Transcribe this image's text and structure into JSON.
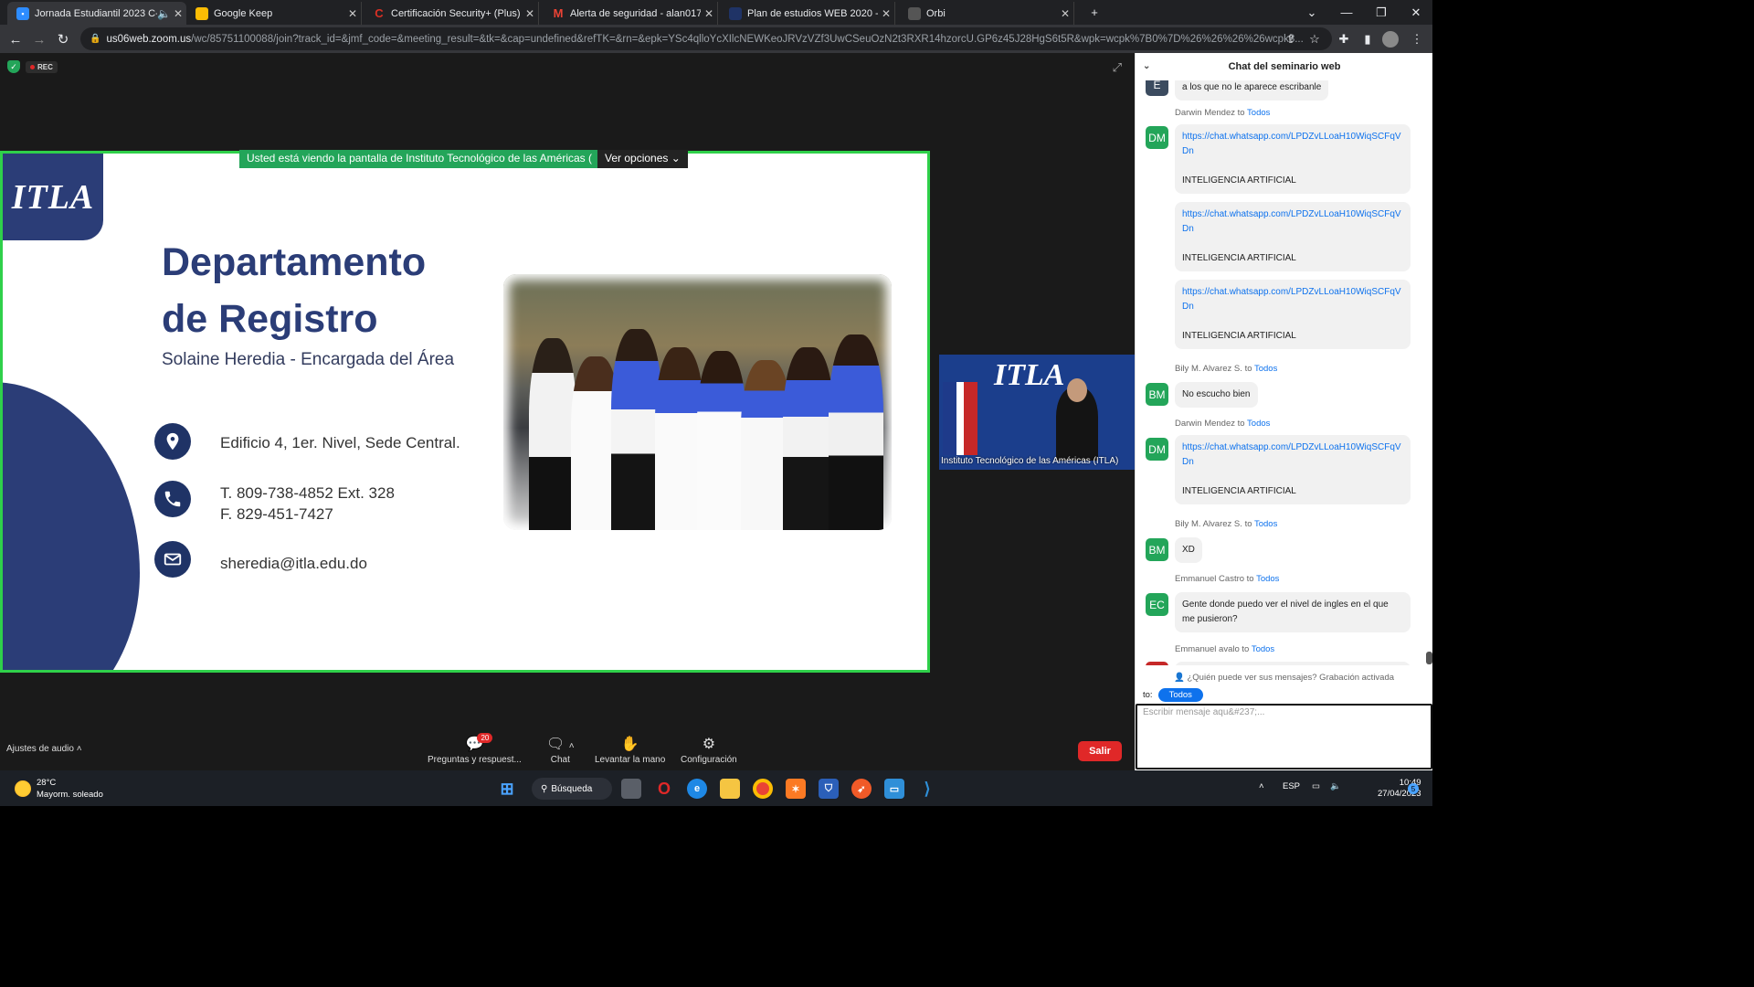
{
  "browser": {
    "tabs": [
      {
        "title": "Jornada Estudiantil 2023 C-2",
        "icon": "zoom-icon",
        "color": "#2d8cff"
      },
      {
        "title": "Google Keep",
        "icon": "keep-icon",
        "color": "#fbbc04"
      },
      {
        "title": "Certificación Security+ (Plus) | Ce",
        "icon": "c-icon",
        "color": "#d93025"
      },
      {
        "title": "Alerta de seguridad - alan017per",
        "icon": "gmail-icon",
        "color": "#ea4335"
      },
      {
        "title": "Plan de estudios WEB 2020 - soft",
        "icon": "page-icon",
        "color": "#1f3366"
      },
      {
        "title": "Orbi",
        "icon": "orbi-icon",
        "color": "#666666"
      }
    ],
    "url_host": "us06web.zoom.us",
    "url_path": "/wc/85751100088/join?track_id=&jmf_code=&meeting_result=&tk=&cap=undefined&refTK=&rn=&epk=YSc4qlloYcXIlcNEWKeoJRVzVZf3UwCSeuOzN2t3RXR14hzorcU.GP6z45J28HgS6t5R&wpk=wcpk%7B0%7D%26%26%26%26wcpk8..."
  },
  "meeting": {
    "rec_label": "REC",
    "share_banner": "Usted está viendo la pantalla de Instituto Tecnológico de las Américas (",
    "view_options": "Ver opciones"
  },
  "slide": {
    "logo": "ITLA",
    "title_line1": "Departamento",
    "title_line2": "de Registro",
    "subtitle": "Solaine Heredia - Encargada del Área",
    "address": "Edificio 4, 1er. Nivel, Sede Central.",
    "phone": "T. 809-738-4852 Ext. 328",
    "fax": "F. 829-451-7427",
    "email": "sheredia@itla.edu.do"
  },
  "video": {
    "logo": "ITLA",
    "participant_name": "Instituto Tecnológico de las Américas (ITLA)"
  },
  "chat": {
    "title": "Chat del seminario web",
    "to_word": "to",
    "todos": "Todos",
    "partial_top_text": "a los que no le aparece escribanle",
    "partial_top_avatar": "E",
    "link": "https://chat.whatsapp.com/LPDZvLLoaH10WiqSCFqVDn",
    "ai_text": "INTELIGENCIA ARTIFICIAL",
    "messages": [
      {
        "sender": "Darwin Mendez",
        "avatar": "DM"
      },
      {
        "sender": "Bily M. Alvarez S.",
        "avatar": "BM",
        "text": "No escucho bien"
      },
      {
        "sender": "Darwin Mendez",
        "avatar": "DM"
      },
      {
        "sender": "Bily M. Alvarez S.",
        "avatar": "BM",
        "text": "XD"
      },
      {
        "sender": "Emmanuel Castro",
        "avatar": "EC",
        "text": "Gente donde puedo ver el nivel de ingles en el que me pusieron?"
      },
      {
        "sender": "Emmanuel avalo"
      }
    ],
    "note": "¿Quién puede ver sus mensajes? Grabación activada",
    "to_label": "to:",
    "input_placeholder": "Escribir mensaje aqu&#237;..."
  },
  "footer": {
    "audio_settings": "Ajustes de audio",
    "qa_label": "Preguntas y respuest...",
    "qa_badge": "20",
    "chat_label": "Chat",
    "raise_hand": "Levantar la mano",
    "settings": "Configuración",
    "leave": "Salir"
  },
  "taskbar": {
    "temperature": "28°C",
    "weather": "Mayorm. soleado",
    "search": "Búsqueda",
    "language": "ESP",
    "time": "10:49",
    "date": "27/04/2023",
    "notifications": "5"
  }
}
